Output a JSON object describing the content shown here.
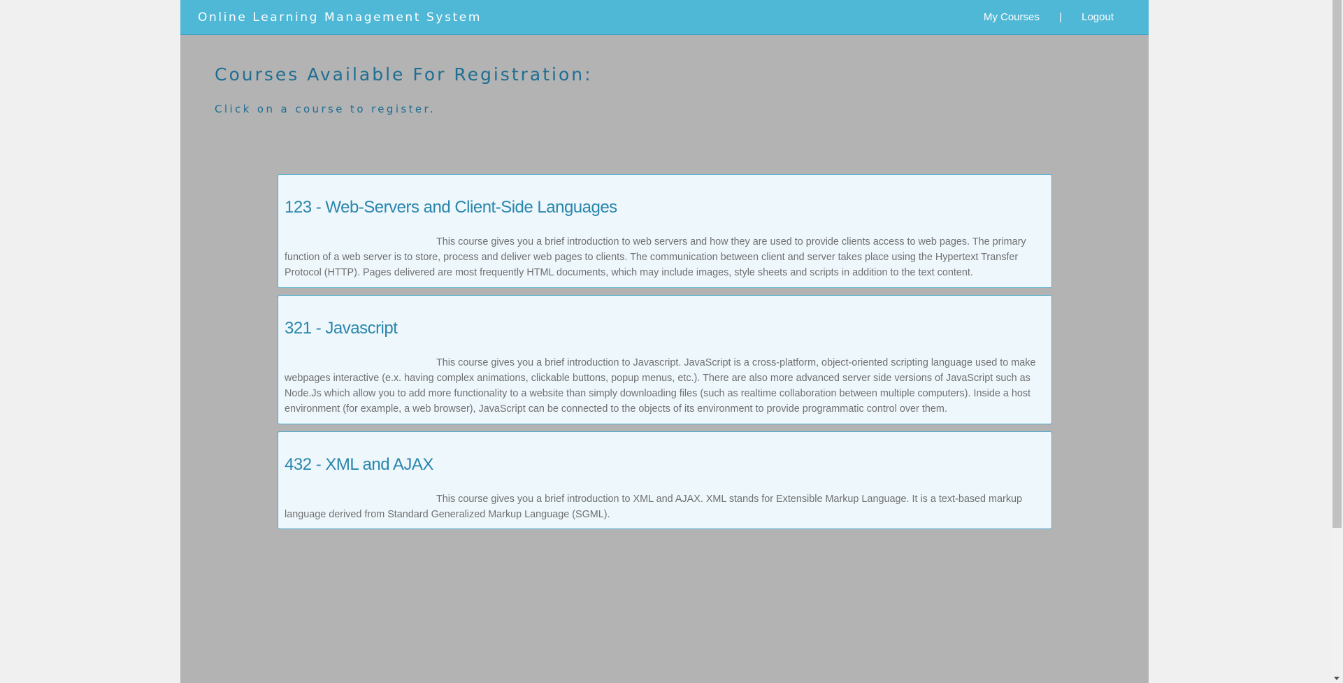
{
  "navbar": {
    "brand": "Online Learning Management System",
    "my_courses": "My Courses",
    "separator": "|",
    "logout": "Logout"
  },
  "main": {
    "heading": "Courses Available For Registration:",
    "subheading": "Click on a course to register."
  },
  "courses": [
    {
      "title": "123 - Web-Servers and Client-Side Languages",
      "description": "This course gives you a brief introduction to web servers and how they are used to provide clients access to web pages. The primary function of a web server is to store, process and deliver web pages to clients. The communication between client and server takes place using the Hypertext Transfer Protocol (HTTP). Pages delivered are most frequently HTML documents, which may include images, style sheets and scripts in addition to the text content."
    },
    {
      "title": "321 - Javascript",
      "description": "This course gives you a brief introduction to Javascript. JavaScript is a cross-platform, object-oriented scripting language used to make webpages interactive (e.x. having complex animations, clickable buttons, popup menus, etc.). There are also more advanced server side versions of JavaScript such as Node.Js which allow you to add more functionality to a website than simply downloading files (such as realtime collaboration between multiple computers). Inside a host environment (for example, a web browser), JavaScript can be connected to the objects of its environment to provide programmatic control over them."
    },
    {
      "title": "432 - XML and AJAX",
      "description": "This course gives you a brief introduction to XML and AJAX. XML stands for Extensible Markup Language. It is a text-based markup language derived from Standard Generalized Markup Language (SGML)."
    }
  ],
  "colors": {
    "navbar": "#4fb8d6",
    "page_background": "#b3b3b3",
    "heading_text": "#1f6e93",
    "course_title": "#2a86ad",
    "course_background": "#eef7fc"
  }
}
